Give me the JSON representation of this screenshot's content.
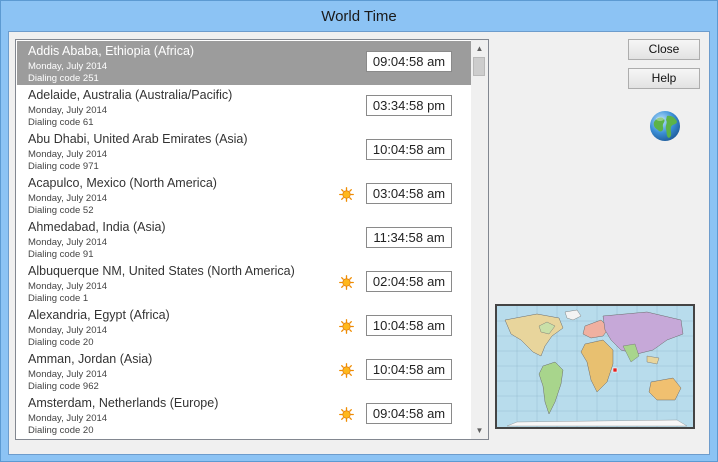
{
  "window": {
    "title": "World Time"
  },
  "buttons": {
    "close": "Close",
    "help": "Help"
  },
  "cities": [
    {
      "name": "Addis Ababa, Ethiopia (Africa)",
      "date": "Monday, July 2014",
      "dialing": "Dialing code 251",
      "time": "09:04:58 am",
      "sun": false,
      "selected": true
    },
    {
      "name": "Adelaide, Australia (Australia/Pacific)",
      "date": "Monday, July 2014",
      "dialing": "Dialing code 61",
      "time": "03:34:58 pm",
      "sun": false,
      "selected": false
    },
    {
      "name": "Abu Dhabi, United Arab Emirates (Asia)",
      "date": "Monday, July 2014",
      "dialing": "Dialing code 971",
      "time": "10:04:58 am",
      "sun": false,
      "selected": false
    },
    {
      "name": "Acapulco, Mexico (North America)",
      "date": "Monday, July 2014",
      "dialing": "Dialing code 52",
      "time": "03:04:58 am",
      "sun": true,
      "selected": false
    },
    {
      "name": "Ahmedabad, India (Asia)",
      "date": "Monday, July 2014",
      "dialing": "Dialing code 91",
      "time": "11:34:58 am",
      "sun": false,
      "selected": false
    },
    {
      "name": "Albuquerque NM, United States (North America)",
      "date": "Monday, July 2014",
      "dialing": "Dialing code 1",
      "time": "02:04:58 am",
      "sun": true,
      "selected": false
    },
    {
      "name": "Alexandria, Egypt (Africa)",
      "date": "Monday, July 2014",
      "dialing": "Dialing code 20",
      "time": "10:04:58 am",
      "sun": true,
      "selected": false
    },
    {
      "name": "Amman, Jordan (Asia)",
      "date": "Monday, July 2014",
      "dialing": "Dialing code 962",
      "time": "10:04:58 am",
      "sun": true,
      "selected": false
    },
    {
      "name": "Amsterdam, Netherlands (Europe)",
      "date": "Monday, July 2014",
      "dialing": "Dialing code 20",
      "time": "09:04:58 am",
      "sun": true,
      "selected": false
    }
  ],
  "icons": {
    "sun": "sun-icon",
    "globe": "globe-icon",
    "scroll_up": "scroll-up-arrow-icon",
    "scroll_down": "scroll-down-arrow-icon"
  },
  "colors": {
    "selection": "#9c9c9c",
    "title_bar": "#8cc3f4",
    "sun": "#f5a623",
    "map_marker": "#e02020"
  }
}
